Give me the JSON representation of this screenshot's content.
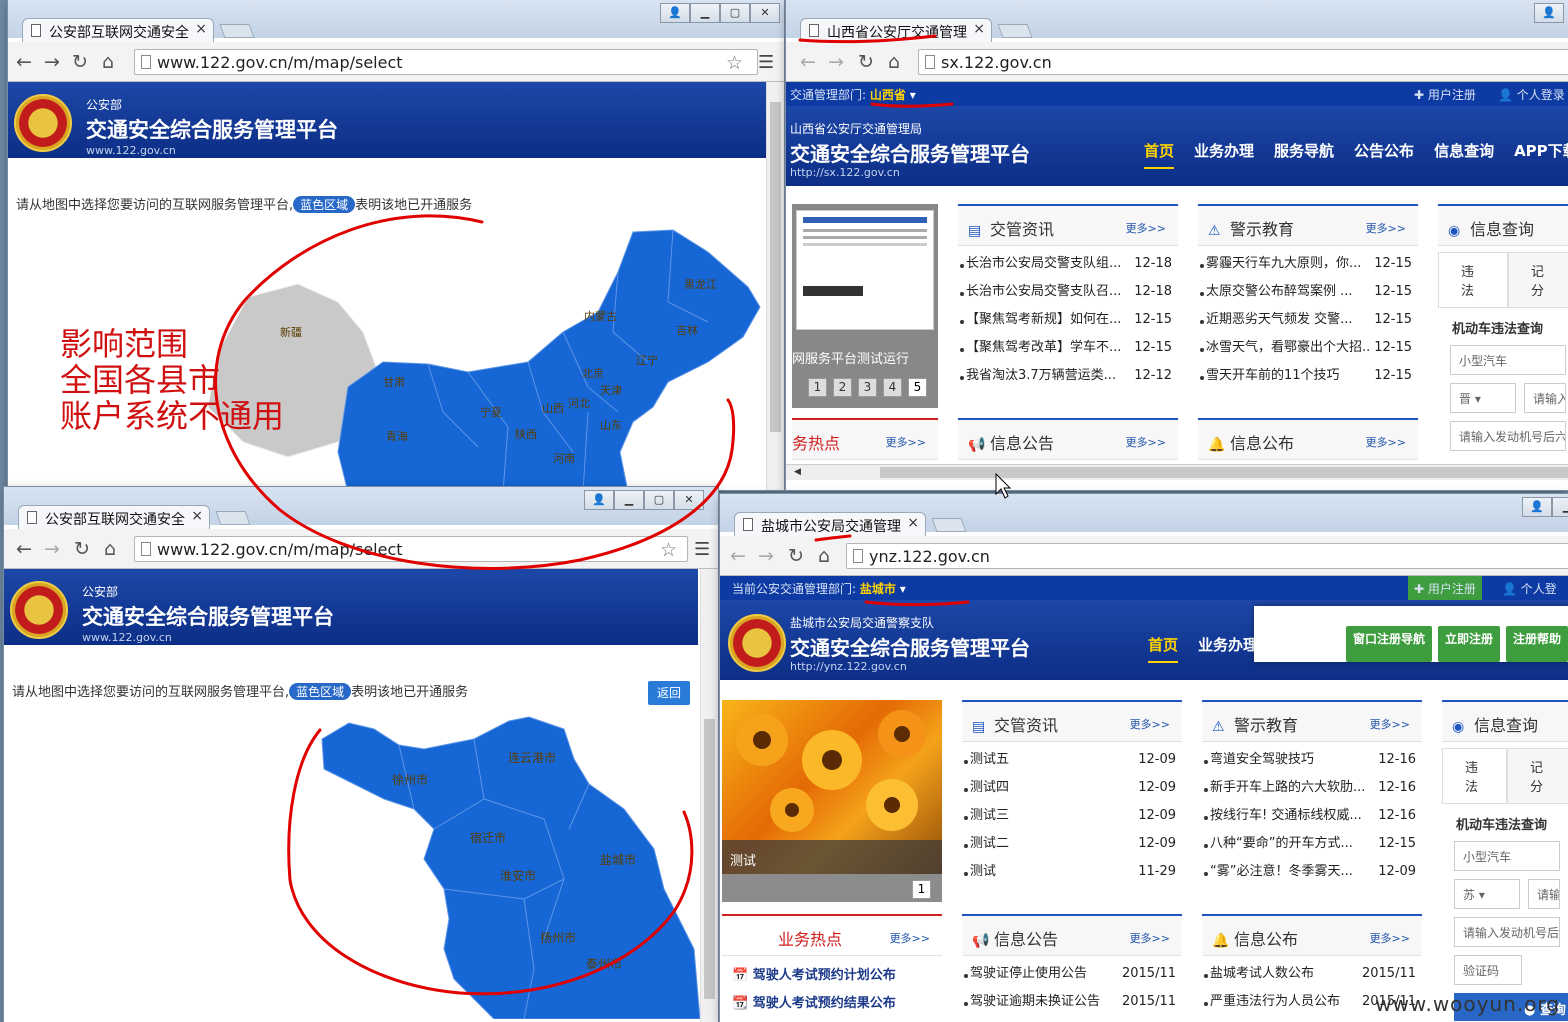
{
  "desktop": {
    "watermark": "www.wooyun.org"
  },
  "win1": {
    "tab_title": "公安部互联网交通安全",
    "url": "www.122.gov.cn/m/map/select",
    "header": {
      "small": "公安部",
      "title": "交通安全综合服务管理平台",
      "url": "www.122.gov.cn"
    },
    "hint_before": "请从地图中选择您要访问的互联网服务管理平台,",
    "hint_pill": "蓝色区域",
    "hint_after": "表明该地已开通服务",
    "provinces": [
      "新疆",
      "甘肃",
      "内蒙古",
      "黑龙江",
      "吉林",
      "辽宁",
      "北京",
      "天津",
      "河北",
      "山西",
      "宁夏",
      "陕西",
      "青海",
      "山东",
      "河南"
    ],
    "annotation": [
      "影响范围",
      "全国各县市",
      "账户系统不通用"
    ]
  },
  "win2": {
    "tab_title": "山西省公安厅交通管理",
    "url": "sx.122.gov.cn",
    "topbar": {
      "label": "交通管理部门:",
      "region": "山西省",
      "register": "用户注册",
      "login": "个人登录"
    },
    "header": {
      "small": "山西省公安厅交通管理局",
      "title": "交通安全综合服务管理平台",
      "url": "http://sx.122.gov.cn"
    },
    "nav": [
      "首页",
      "业务办理",
      "服务导航",
      "公告公布",
      "信息查询",
      "APP下载"
    ],
    "carousel_caption": "网服务平台测试运行",
    "carousel_pages": [
      "1",
      "2",
      "3",
      "4",
      "5"
    ],
    "news": {
      "title": "交管资讯",
      "more": "更多>>",
      "items": [
        {
          "t": "长治市公安局交警支队组...",
          "d": "12-18"
        },
        {
          "t": "长治市公安局交警支队召...",
          "d": "12-18"
        },
        {
          "t": "【聚焦驾考新规】如何在...",
          "d": "12-15"
        },
        {
          "t": "【聚焦驾考改革】学车不...",
          "d": "12-15"
        },
        {
          "t": "我省淘汰3.7万辆营运类...",
          "d": "12-12"
        }
      ]
    },
    "warn": {
      "title": "警示教育",
      "more": "更多>>",
      "items": [
        {
          "t": "雾霾天行车九大原则，你...",
          "d": "12-15"
        },
        {
          "t": "太原交警公布醉驾案例 ...",
          "d": "12-15"
        },
        {
          "t": "近期恶劣天气频发 交警...",
          "d": "12-15"
        },
        {
          "t": "冰雪天气，看鄂豪出个大招...",
          "d": "12-15"
        },
        {
          "t": "雪天开车前的11个技巧",
          "d": "12-15"
        }
      ]
    },
    "query": {
      "title": "信息查询",
      "tab1": "违法",
      "tab2": "记分",
      "label": "机动车违法查询",
      "vehicle": "小型汽车",
      "prov": "晋",
      "plate_ph": "请输入",
      "engine_ph": "请输入发动机号后六"
    },
    "hot": {
      "title": "务热点",
      "more": "更多>>"
    },
    "notice": {
      "title": "信息公告",
      "more": "更多>>"
    },
    "publish": {
      "title": "信息公布",
      "more": "更多>>"
    }
  },
  "win3": {
    "tab_title": "公安部互联网交通安全",
    "url": "www.122.gov.cn/m/map/select",
    "header": {
      "small": "公安部",
      "title": "交通安全综合服务管理平台",
      "url": "www.122.gov.cn"
    },
    "hint_before": "请从地图中选择您要访问的互联网服务管理平台,",
    "hint_pill": "蓝色区域",
    "hint_after": "表明该地已开通服务",
    "back": "返回",
    "cities": [
      "徐州市",
      "连云港市",
      "宿迁市",
      "淮安市",
      "盐城市",
      "扬州市",
      "泰州市"
    ]
  },
  "win4": {
    "tab_title": "盐城市公安局交通管理",
    "url": "ynz.122.gov.cn",
    "topbar": {
      "label": "当前公安交通管理部门:",
      "region": "盐城市",
      "register": "用户注册",
      "login": "个人登录"
    },
    "header": {
      "small": "盐城市公安局交通警察支队",
      "title": "交通安全综合服务管理平台",
      "url": "http://ynz.122.gov.cn"
    },
    "nav": [
      "首页",
      "业务办理"
    ],
    "popup": [
      "窗口注册导航",
      "立即注册",
      "注册帮助"
    ],
    "carousel_caption": "测试",
    "carousel_page": "1",
    "news": {
      "title": "交管资讯",
      "more": "更多>>",
      "items": [
        {
          "t": "测试五",
          "d": "12-09"
        },
        {
          "t": "测试四",
          "d": "12-09"
        },
        {
          "t": "测试三",
          "d": "12-09"
        },
        {
          "t": "测试二",
          "d": "12-09"
        },
        {
          "t": "测试",
          "d": "11-29"
        }
      ]
    },
    "warn": {
      "title": "警示教育",
      "more": "更多>>",
      "items": [
        {
          "t": "弯道安全驾驶技巧",
          "d": "12-16"
        },
        {
          "t": "新手开车上路的六大软肋...",
          "d": "12-16"
        },
        {
          "t": "按线行车! 交通标线权威...",
          "d": "12-16"
        },
        {
          "t": "八种“要命”的开车方式...",
          "d": "12-15"
        },
        {
          "t": "“雾”必注意！冬季雾天...",
          "d": "12-09"
        }
      ]
    },
    "query": {
      "title": "信息查询",
      "tab1": "违法",
      "tab2": "记分",
      "label": "机动车违法查询",
      "vehicle": "小型汽车",
      "prov": "苏",
      "plate_ph": "请输入",
      "engine_ph": "请输入发动机号后六",
      "captcha_ph": "验证码",
      "submit": "查询"
    },
    "hot": {
      "title": "业务热点",
      "more": "更多>>",
      "items": [
        "驾驶人考试预约计划公布",
        "驾驶人考试预约结果公布"
      ]
    },
    "notice": {
      "title": "信息公告",
      "more": "更多>>",
      "items": [
        {
          "t": "驾驶证停止使用公告",
          "d": "2015/11"
        },
        {
          "t": "驾驶证逾期未换证公告",
          "d": "2015/11"
        }
      ]
    },
    "publish": {
      "title": "信息公布",
      "more": "更多>>",
      "items": [
        {
          "t": "盐城考试人数公布",
          "d": "2015/11"
        },
        {
          "t": "严重违法行为人员公布",
          "d": "2015/11"
        }
      ]
    }
  },
  "colors": {
    "brand_blue": "#0c2e86",
    "map_blue": "#1666d5",
    "annotation_red": "#e00000",
    "accent_yellow": "#ffd200"
  }
}
